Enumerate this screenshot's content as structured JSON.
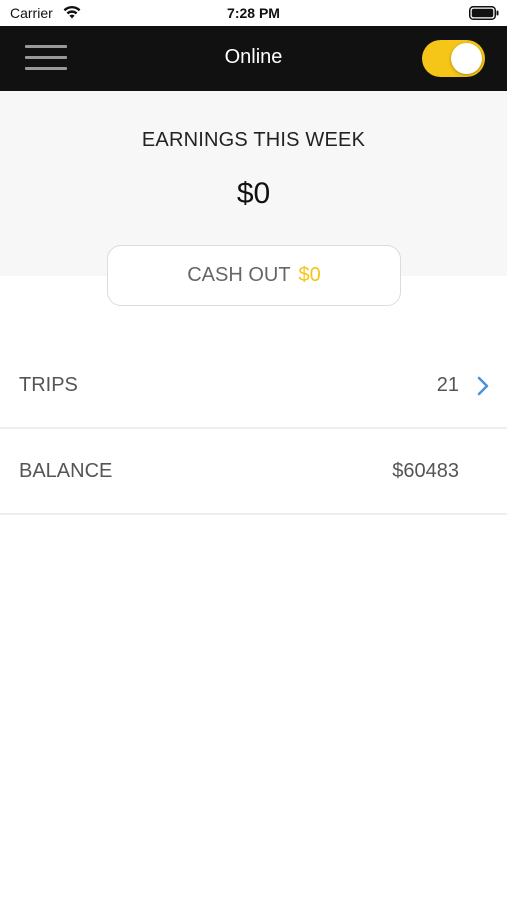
{
  "status_bar": {
    "carrier": "Carrier",
    "time": "7:28 PM",
    "wifi_icon": "wifi-icon",
    "battery_icon": "battery-icon"
  },
  "top_bar": {
    "menu_icon": "hamburger-menu-icon",
    "title": "Online",
    "toggle_on": true,
    "toggle_color": "#f5c518"
  },
  "earnings": {
    "label": "EARNINGS THIS WEEK",
    "value": "$0"
  },
  "cash_out": {
    "label": "CASH OUT",
    "amount": "$0",
    "amount_color": "#f5c518"
  },
  "rows": [
    {
      "label": "TRIPS",
      "value": "21",
      "icon": "chevron-right-icon"
    },
    {
      "label": "BALANCE",
      "value": "$60483"
    }
  ],
  "colors": {
    "accent": "#f5c518",
    "header_bg": "#111111",
    "chevron": "#4a90e2"
  }
}
